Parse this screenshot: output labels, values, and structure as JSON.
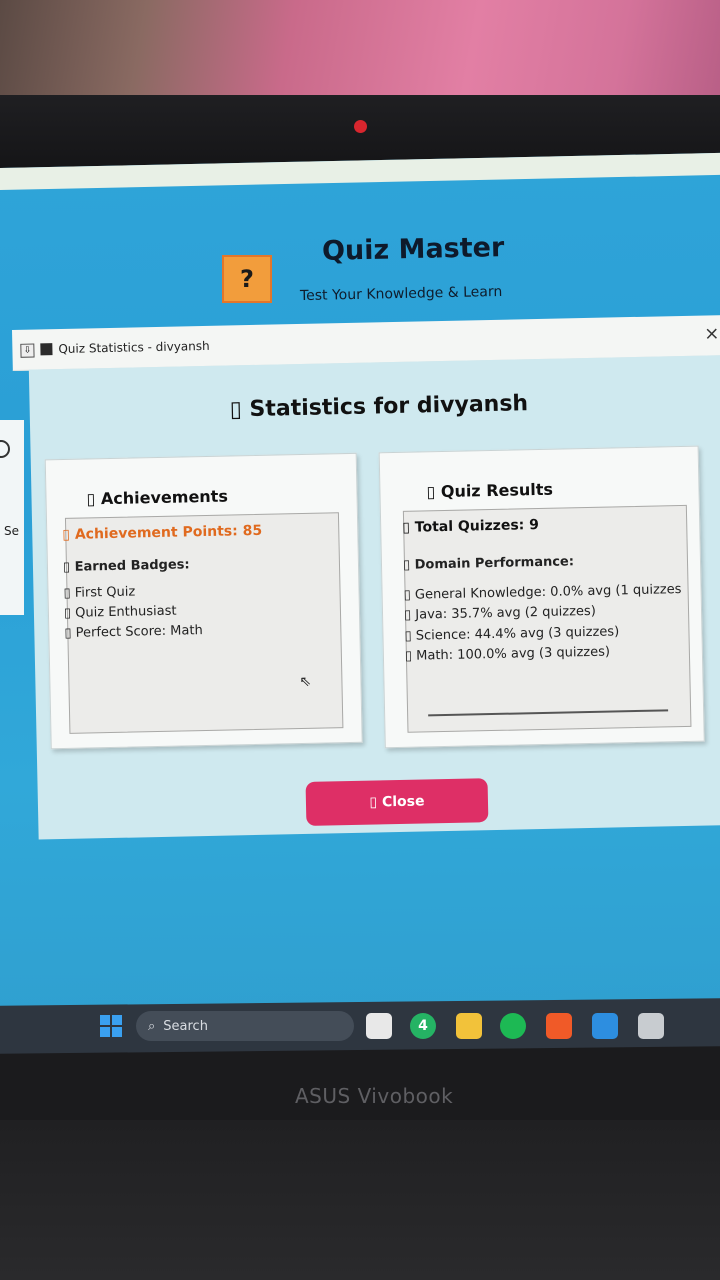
{
  "app": {
    "logo_glyph": "?",
    "title": "Quiz Master",
    "subtitle": "Test Your Knowledge & Learn"
  },
  "behind_window": {
    "partial_text": "Se"
  },
  "stats_window": {
    "title": "Quiz Statistics - divyansh",
    "close_glyph": "×",
    "heading": "▯ Statistics for divyansh",
    "achievements": {
      "title": "▯ Achievements",
      "points": "▯ Achievement Points: 85",
      "badges_label": "▯ Earned Badges:",
      "badges": [
        "▯ First Quiz",
        "▯ Quiz Enthusiast",
        "▯ Perfect Score: Math"
      ]
    },
    "quiz_results": {
      "title": "▯ Quiz Results",
      "total": "▯ Total Quizzes: 9",
      "domain_label": "▯ Domain Performance:",
      "domains": [
        "▯ General Knowledge: 0.0% avg (1 quizzes",
        "▯ Java: 35.7% avg (2 quizzes)",
        "▯ Science: 44.4% avg (3 quizzes)",
        "▯ Math: 100.0% avg (3 quizzes)"
      ]
    },
    "close_button": "▯ Close"
  },
  "taskbar": {
    "search_label": "Search",
    "whatsapp_badge": "4"
  },
  "laptop_brand": "ASUS Vivobook",
  "colors": {
    "accent_close": "#de2f66",
    "achievement_points": "#e06a1f",
    "logo": "#f29d3c",
    "desktop": "#2fa4d8"
  }
}
